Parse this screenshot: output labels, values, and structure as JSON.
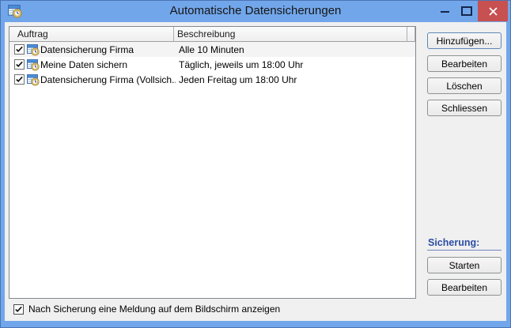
{
  "window": {
    "title": "Automatische Datensicherungen"
  },
  "colors": {
    "titlebar_blue": "#72a6ea",
    "close_button_red": "#c75050",
    "section_label_blue": "#2b4ea3",
    "client_gray": "#f0f0f0"
  },
  "icons": {
    "app": "scheduled-backup-icon",
    "row": "scheduled-task-icon",
    "minimize": "minimize-dash",
    "maximize": "maximize-square",
    "close": "close-x"
  },
  "list": {
    "columns": [
      {
        "label": "Auftrag"
      },
      {
        "label": "Beschreibung"
      }
    ],
    "rows": [
      {
        "checked": true,
        "name": "Datensicherung Firma",
        "description": "Alle 10 Minuten"
      },
      {
        "checked": true,
        "name": "Meine Daten sichern",
        "description": "Täglich, jeweils um 18:00 Uhr"
      },
      {
        "checked": true,
        "name": "Datensicherung Firma (Vollsich...",
        "description": "Jeden Freitag um 18:00 Uhr"
      }
    ]
  },
  "buttons": {
    "add": "Hinzufügen...",
    "edit": "Bearbeiten",
    "delete": "Löschen",
    "close": "Schliessen"
  },
  "backup_section": {
    "label": "Sicherung:",
    "start": "Starten",
    "edit": "Bearbeiten"
  },
  "footer": {
    "checked": true,
    "label": "Nach Sicherung eine Meldung auf dem Bildschirm anzeigen"
  }
}
